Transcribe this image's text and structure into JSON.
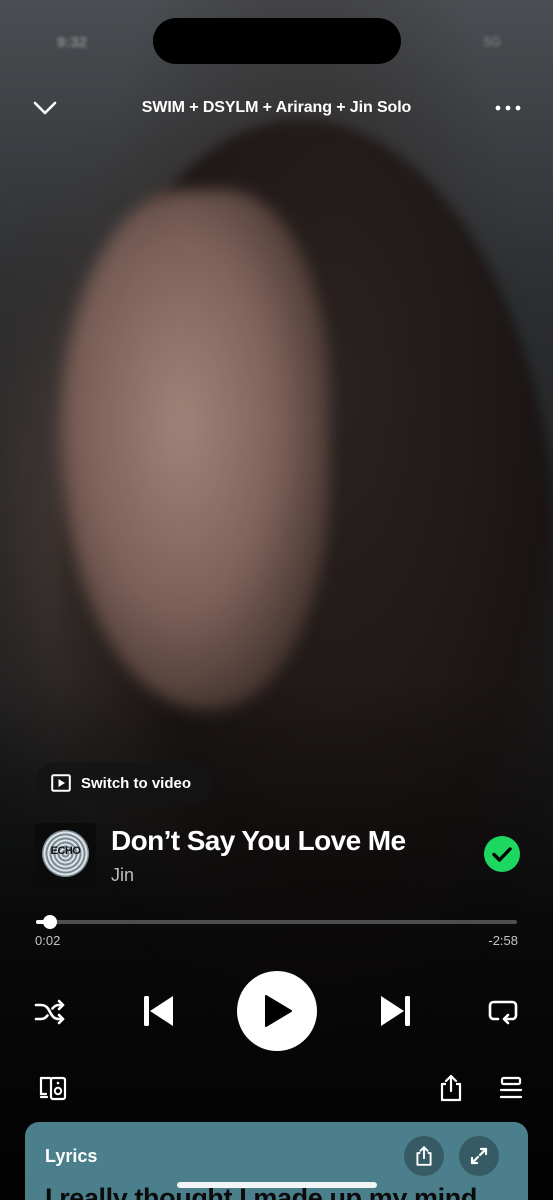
{
  "status": {
    "time": "9:32",
    "right": "5G"
  },
  "header": {
    "title": "SWIM + DSYLM + Arirang + Jin Solo"
  },
  "switch_video": {
    "label": "Switch to video"
  },
  "track": {
    "title": "Don’t Say You Love Me",
    "artist": "Jin",
    "cover_text": "ECHO",
    "saved": true
  },
  "progress": {
    "fraction": 0.02,
    "elapsed": "0:02",
    "remaining": "-2:58"
  },
  "playback": {
    "state": "paused"
  },
  "lyrics": {
    "label": "Lyrics",
    "line": "I really thought I made up my mind"
  },
  "colors": {
    "accent_green": "#1ed760",
    "lyrics_card": "#4b7f8b",
    "background": "#0c0c0c"
  },
  "icons": [
    "chevron-down-icon",
    "more-icon",
    "video-icon",
    "check-circle-icon",
    "shuffle-icon",
    "previous-icon",
    "play-icon",
    "next-icon",
    "repeat-icon",
    "devices-icon",
    "share-icon",
    "queue-icon",
    "expand-icon"
  ]
}
